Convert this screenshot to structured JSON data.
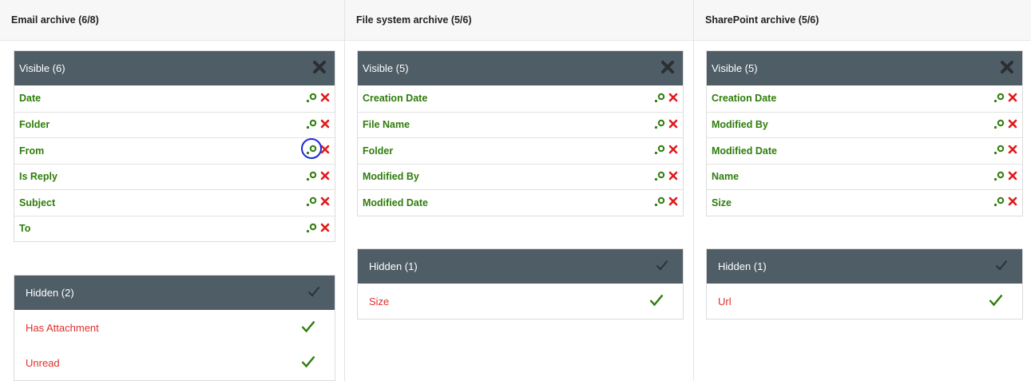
{
  "columns": [
    {
      "title": "Email archive (6/8)",
      "visible_title": "Visible (6)",
      "visible_items": [
        "Date",
        "Folder",
        "From",
        "Is Reply",
        "Subject",
        "To"
      ],
      "hidden_title": "Hidden (2)",
      "hidden_items": [
        "Has Attachment",
        "Unread"
      ]
    },
    {
      "title": "File system archive (5/6)",
      "visible_title": "Visible (5)",
      "visible_items": [
        "Creation Date",
        "File Name",
        "Folder",
        "Modified By",
        "Modified Date"
      ],
      "hidden_title": "Hidden (1)",
      "hidden_items": [
        "Size"
      ]
    },
    {
      "title": "SharePoint archive (5/6)",
      "visible_title": "Visible (5)",
      "visible_items": [
        "Creation Date",
        "Modified By",
        "Modified Date",
        "Name",
        "Size"
      ],
      "hidden_title": "Hidden (1)",
      "hidden_items": [
        "Url"
      ]
    }
  ],
  "icons": {
    "header_visible": "close-icon",
    "header_hidden": "check-icon",
    "row_edit": "key-icon",
    "row_remove": "remove-icon",
    "hidden_restore": "check-icon"
  },
  "colors": {
    "panel_header_bg": "#4f5d66",
    "visible_text": "#2e7d0b",
    "hidden_text": "#e0302a",
    "remove_icon": "#e01b1b",
    "check_icon": "#2e7d0b",
    "highlight_ring": "#1a2bd6"
  }
}
